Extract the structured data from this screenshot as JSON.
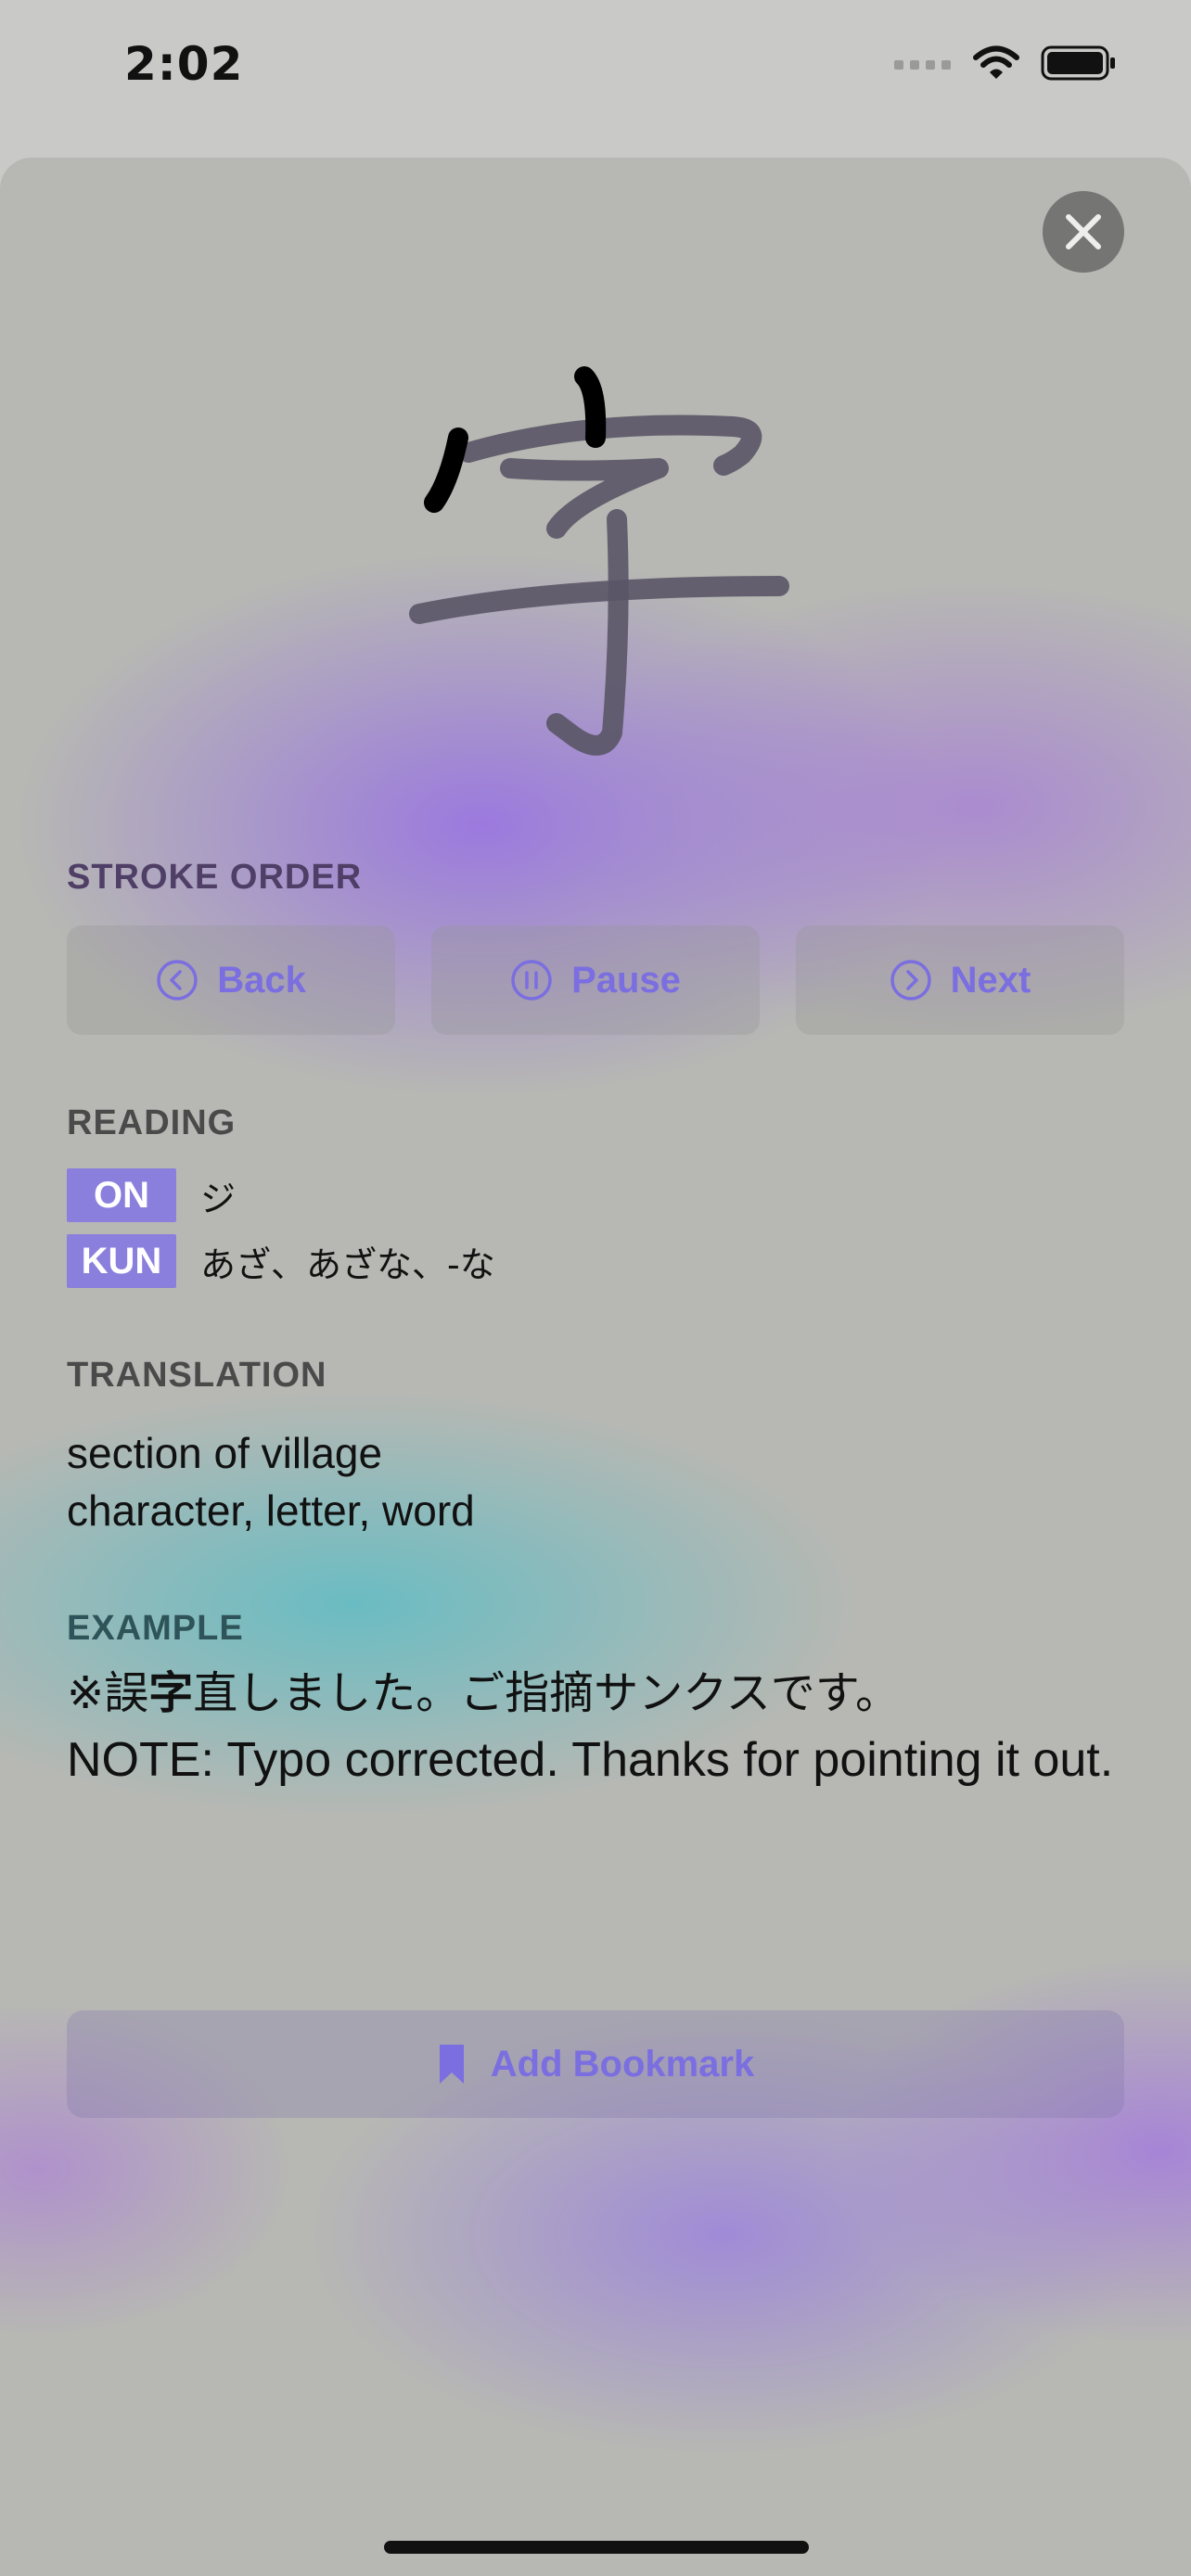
{
  "status_bar": {
    "time": "2:02"
  },
  "kanji": {
    "character": "字"
  },
  "stroke_order": {
    "label": "STROKE ORDER",
    "buttons": [
      {
        "label": "Back",
        "icon": "chevron-left-circle-icon"
      },
      {
        "label": "Pause",
        "icon": "pause-circle-icon"
      },
      {
        "label": "Next",
        "icon": "chevron-right-circle-icon"
      }
    ]
  },
  "reading": {
    "label": "READING",
    "on": {
      "badge": "ON",
      "value": "ジ"
    },
    "kun": {
      "badge": "KUN",
      "value": "あざ、あざな、-な"
    }
  },
  "translation": {
    "label": "TRANSLATION",
    "lines": [
      "section of village",
      "character, letter, word"
    ]
  },
  "example": {
    "label": "EXAMPLE",
    "japanese_prefix": "※誤",
    "japanese_highlight": "字",
    "japanese_suffix": "直しました。ご指摘サンクスです。",
    "english": "NOTE: Typo corrected. Thanks for pointing it out."
  },
  "bookmark": {
    "label": "Add Bookmark",
    "icon": "bookmark-icon"
  },
  "colors": {
    "accent": "#7a6ee0",
    "badge": "#8a7fdc",
    "stroke_active": "#000000",
    "stroke_pending": "#5a5566"
  }
}
